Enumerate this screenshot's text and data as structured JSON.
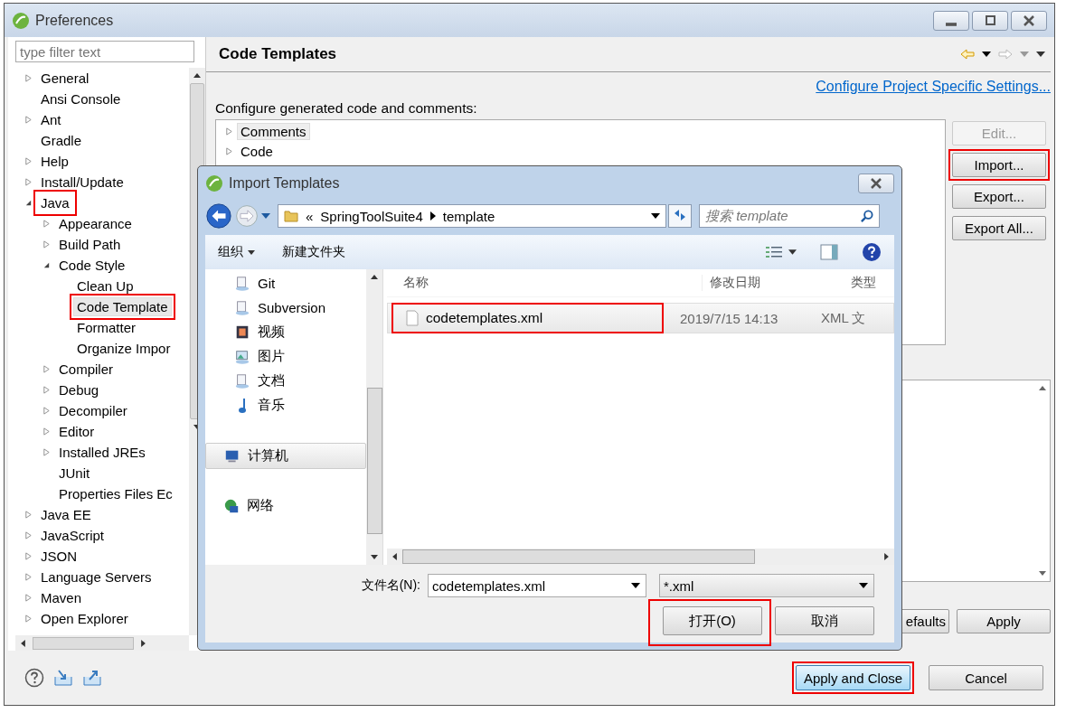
{
  "window": {
    "title": "Preferences"
  },
  "filter": {
    "placeholder": "type filter text"
  },
  "tree": [
    {
      "label": "General",
      "expanded": false,
      "selected": false,
      "highlighted": false
    },
    {
      "label": "Ansi Console",
      "selected": false,
      "highlighted": false
    },
    {
      "label": "Ant",
      "expanded": false,
      "selected": false,
      "highlighted": false
    },
    {
      "label": "Gradle",
      "selected": false,
      "highlighted": false
    },
    {
      "label": "Help",
      "expanded": false,
      "selected": false,
      "highlighted": false
    },
    {
      "label": "Install/Update",
      "expanded": false,
      "selected": false,
      "highlighted": false
    },
    {
      "label": "Java",
      "expanded": true,
      "selected": false,
      "highlighted": true,
      "children": [
        {
          "label": "Appearance",
          "expanded": false,
          "selected": false,
          "highlighted": false
        },
        {
          "label": "Build Path",
          "expanded": false,
          "selected": false,
          "highlighted": false
        },
        {
          "label": "Code Style",
          "expanded": true,
          "selected": false,
          "highlighted": false,
          "children": [
            {
              "label": "Clean Up",
              "selected": false,
              "highlighted": false
            },
            {
              "label": "Code Template",
              "selected": true,
              "highlighted": true
            },
            {
              "label": "Formatter",
              "selected": false,
              "highlighted": false
            },
            {
              "label": "Organize Impor",
              "selected": false,
              "highlighted": false
            }
          ]
        },
        {
          "label": "Compiler",
          "expanded": false,
          "selected": false,
          "highlighted": false
        },
        {
          "label": "Debug",
          "expanded": false,
          "selected": false,
          "highlighted": false
        },
        {
          "label": "Decompiler",
          "expanded": false,
          "selected": false,
          "highlighted": false
        },
        {
          "label": "Editor",
          "expanded": false,
          "selected": false,
          "highlighted": false
        },
        {
          "label": "Installed JREs",
          "expanded": false,
          "selected": false,
          "highlighted": false
        },
        {
          "label": "JUnit",
          "selected": false,
          "highlighted": false
        },
        {
          "label": "Properties Files Ec",
          "selected": false,
          "highlighted": false
        }
      ]
    },
    {
      "label": "Java EE",
      "expanded": false,
      "selected": false,
      "highlighted": false
    },
    {
      "label": "JavaScript",
      "expanded": false,
      "selected": false,
      "highlighted": false
    },
    {
      "label": "JSON",
      "expanded": false,
      "selected": false,
      "highlighted": false
    },
    {
      "label": "Language Servers",
      "expanded": false,
      "selected": false,
      "highlighted": false
    },
    {
      "label": "Maven",
      "expanded": false,
      "selected": false,
      "highlighted": false
    },
    {
      "label": "Open Explorer",
      "expanded": false,
      "selected": false,
      "highlighted": false
    }
  ],
  "page": {
    "title": "Code Templates",
    "link": "Configure Project Specific Settings...",
    "description": "Configure generated code and comments:",
    "templates": [
      {
        "label": "Comments",
        "selected": true
      },
      {
        "label": "Code",
        "selected": false
      }
    ],
    "buttons": [
      {
        "label": "Edit...",
        "disabled": true,
        "highlighted": false
      },
      {
        "label": "Import...",
        "disabled": false,
        "highlighted": true
      },
      {
        "label": "Export...",
        "disabled": false,
        "highlighted": false
      },
      {
        "label": "Export All...",
        "disabled": false,
        "highlighted": false
      }
    ],
    "bottom_buttons": [
      {
        "label": "efaults"
      },
      {
        "label": "Apply"
      }
    ]
  },
  "footer": {
    "buttons": [
      {
        "label": "Apply and Close",
        "default": true,
        "highlighted": true
      },
      {
        "label": "Cancel",
        "default": false,
        "highlighted": false
      }
    ]
  },
  "dialog": {
    "title": "Import Templates",
    "path": [
      "SpringToolSuite4",
      "template"
    ],
    "path_prefix": "«",
    "search": {
      "placeholder": "搜索 template"
    },
    "toolbar": [
      {
        "label": "组织",
        "dropdown": true
      },
      {
        "label": "新建文件夹",
        "dropdown": false
      }
    ],
    "nav": [
      {
        "label": "Git",
        "kind": "git",
        "selected": false
      },
      {
        "label": "Subversion",
        "kind": "svn",
        "selected": false
      },
      {
        "label": "视频",
        "kind": "video",
        "selected": false
      },
      {
        "label": "图片",
        "kind": "pictures",
        "selected": false
      },
      {
        "label": "文档",
        "kind": "docs",
        "selected": false
      },
      {
        "label": "音乐",
        "kind": "music",
        "selected": false
      },
      {
        "label": "计算机",
        "kind": "computer",
        "selected": true
      },
      {
        "label": "网络",
        "kind": "network",
        "selected": false
      }
    ],
    "columns": [
      "名称",
      "修改日期",
      "类型"
    ],
    "files": [
      {
        "name": "codetemplates.xml",
        "modified": "2019/7/15 14:13",
        "type": "XML 文",
        "selected": true,
        "highlighted": true
      }
    ],
    "filename_label": "文件名(N):",
    "filename": "codetemplates.xml",
    "filter": "*.xml",
    "buttons": [
      {
        "label": "打开(O)",
        "highlighted": true
      },
      {
        "label": "取消",
        "highlighted": false
      }
    ]
  }
}
